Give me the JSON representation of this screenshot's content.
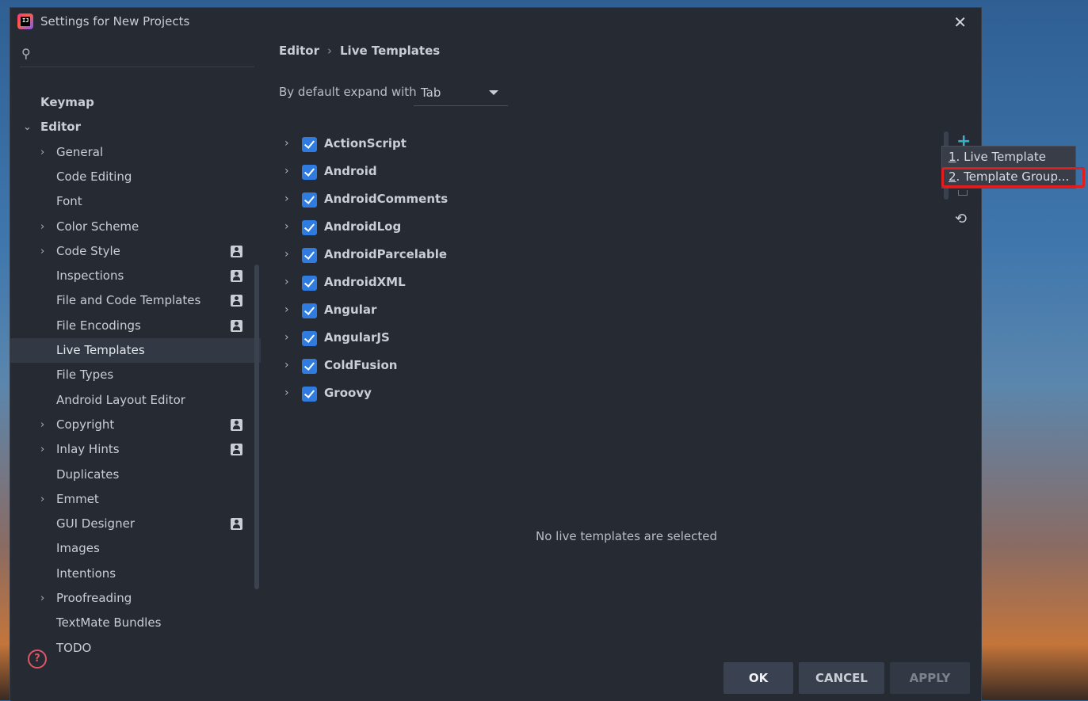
{
  "window": {
    "title": "Settings for New Projects"
  },
  "sidebar": {
    "search_placeholder": "",
    "items": [
      {
        "label": "Keymap",
        "level": 0,
        "arrow": "",
        "project_icon": false
      },
      {
        "label": "Editor",
        "level": 0,
        "arrow": "⌄",
        "project_icon": false
      },
      {
        "label": "General",
        "level": 1,
        "arrow": "›",
        "project_icon": false
      },
      {
        "label": "Code Editing",
        "level": 1,
        "arrow": "",
        "project_icon": false
      },
      {
        "label": "Font",
        "level": 1,
        "arrow": "",
        "project_icon": false
      },
      {
        "label": "Color Scheme",
        "level": 1,
        "arrow": "›",
        "project_icon": false
      },
      {
        "label": "Code Style",
        "level": 1,
        "arrow": "›",
        "project_icon": true
      },
      {
        "label": "Inspections",
        "level": 1,
        "arrow": "",
        "project_icon": true
      },
      {
        "label": "File and Code Templates",
        "level": 1,
        "arrow": "",
        "project_icon": true
      },
      {
        "label": "File Encodings",
        "level": 1,
        "arrow": "",
        "project_icon": true
      },
      {
        "label": "Live Templates",
        "level": 1,
        "arrow": "",
        "project_icon": false,
        "selected": true
      },
      {
        "label": "File Types",
        "level": 1,
        "arrow": "",
        "project_icon": false
      },
      {
        "label": "Android Layout Editor",
        "level": 1,
        "arrow": "",
        "project_icon": false
      },
      {
        "label": "Copyright",
        "level": 1,
        "arrow": "›",
        "project_icon": true
      },
      {
        "label": "Inlay Hints",
        "level": 1,
        "arrow": "›",
        "project_icon": true
      },
      {
        "label": "Duplicates",
        "level": 1,
        "arrow": "",
        "project_icon": false
      },
      {
        "label": "Emmet",
        "level": 1,
        "arrow": "›",
        "project_icon": false
      },
      {
        "label": "GUI Designer",
        "level": 1,
        "arrow": "",
        "project_icon": true
      },
      {
        "label": "Images",
        "level": 1,
        "arrow": "",
        "project_icon": false
      },
      {
        "label": "Intentions",
        "level": 1,
        "arrow": "",
        "project_icon": false
      },
      {
        "label": "Proofreading",
        "level": 1,
        "arrow": "›",
        "project_icon": false
      },
      {
        "label": "TextMate Bundles",
        "level": 1,
        "arrow": "",
        "project_icon": false
      },
      {
        "label": "TODO",
        "level": 1,
        "arrow": "",
        "project_icon": false
      }
    ]
  },
  "breadcrumb": {
    "parent": "Editor",
    "sep": "›",
    "current": "Live Templates"
  },
  "expand": {
    "label": "By default expand with",
    "value": "Tab"
  },
  "groups": [
    {
      "name": "ActionScript",
      "checked": true
    },
    {
      "name": "Android",
      "checked": true
    },
    {
      "name": "AndroidComments",
      "checked": true
    },
    {
      "name": "AndroidLog",
      "checked": true
    },
    {
      "name": "AndroidParcelable",
      "checked": true
    },
    {
      "name": "AndroidXML",
      "checked": true
    },
    {
      "name": "Angular",
      "checked": true
    },
    {
      "name": "AngularJS",
      "checked": true
    },
    {
      "name": "ColdFusion",
      "checked": true
    },
    {
      "name": "Groovy",
      "checked": true
    }
  ],
  "empty_message": "No live templates are selected",
  "toolbar": {
    "add_icon": "plus-icon",
    "restore_icon": "restore-icon"
  },
  "popup": {
    "items": [
      {
        "mnemonic": "1",
        "rest": ". Live Template"
      },
      {
        "mnemonic": "2",
        "rest": ". Template Group..."
      }
    ]
  },
  "buttons": {
    "ok": "OK",
    "cancel": "CANCEL",
    "apply": "APPLY"
  },
  "colors": {
    "accent": "#2f7be0",
    "highlight": "#e21d1d",
    "add": "#3ab0c7"
  }
}
